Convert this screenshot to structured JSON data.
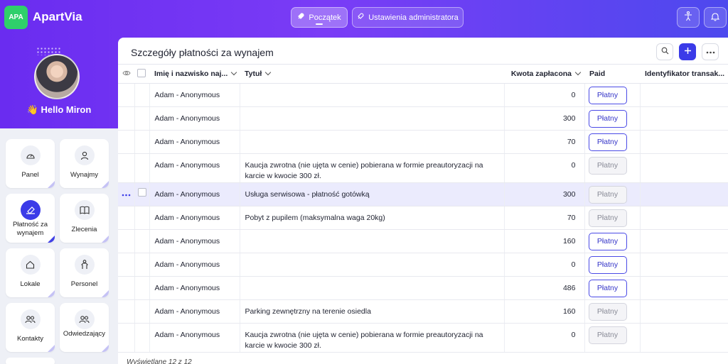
{
  "app": {
    "logo": "APA",
    "name": "ApartVia"
  },
  "nav": {
    "home": "Początek",
    "admin": "Ustawienia administratora"
  },
  "topbar_icons": [
    "accessibility-icon",
    "bell-icon"
  ],
  "profile": {
    "greeting": "👋 Hello Miron"
  },
  "sidebar": {
    "items": [
      {
        "label": "Panel",
        "icon": "dashboard-icon",
        "active": false
      },
      {
        "label": "Wynajmy",
        "icon": "user-icon",
        "active": false
      },
      {
        "label": "Płatność za wynajem",
        "icon": "payment-icon",
        "active": true
      },
      {
        "label": "Zlecenia",
        "icon": "book-icon",
        "active": false
      },
      {
        "label": "Lokale",
        "icon": "home-icon",
        "active": false
      },
      {
        "label": "Personel",
        "icon": "person-icon",
        "active": false
      },
      {
        "label": "Kontakty",
        "icon": "contacts-icon",
        "active": false
      },
      {
        "label": "Odwiedzający",
        "icon": "visitors-icon",
        "active": false
      }
    ]
  },
  "panel": {
    "title": "Szczegóły płatności za wynajem",
    "columns": {
      "name": "Imię i nazwisko naj...",
      "title": "Tytuł",
      "amount": "Kwota zapłacona",
      "paid": "Paid",
      "transaction": "Identyfikator transak..."
    },
    "rows": [
      {
        "name": "Adam - Anonymous",
        "title": "",
        "amount": "0",
        "paid": "Płatny",
        "paid_active": true
      },
      {
        "name": "Adam - Anonymous",
        "title": "",
        "amount": "300",
        "paid": "Płatny",
        "paid_active": true
      },
      {
        "name": "Adam - Anonymous",
        "title": "",
        "amount": "70",
        "paid": "Płatny",
        "paid_active": true
      },
      {
        "name": "Adam - Anonymous",
        "title": "Kaucja zwrotna (nie ujęta w cenie) pobierana w formie preautoryzacji na karcie w kwocie 300 zł.",
        "amount": "0",
        "paid": "Płatny",
        "paid_active": false
      },
      {
        "name": "Adam - Anonymous",
        "title": "Usługa serwisowa - płatność gotówką",
        "amount": "300",
        "paid": "Płatny",
        "paid_active": false
      },
      {
        "name": "Adam - Anonymous",
        "title": "Pobyt z pupilem (maksymalna waga 20kg)",
        "amount": "70",
        "paid": "Płatny",
        "paid_active": false
      },
      {
        "name": "Adam - Anonymous",
        "title": "",
        "amount": "160",
        "paid": "Płatny",
        "paid_active": true
      },
      {
        "name": "Adam - Anonymous",
        "title": "",
        "amount": "0",
        "paid": "Płatny",
        "paid_active": true
      },
      {
        "name": "Adam - Anonymous",
        "title": "",
        "amount": "486",
        "paid": "Płatny",
        "paid_active": true
      },
      {
        "name": "Adam - Anonymous",
        "title": "Parking zewnętrzny na terenie osiedla",
        "amount": "160",
        "paid": "Płatny",
        "paid_active": false
      },
      {
        "name": "Adam - Anonymous",
        "title": "Kaucja zwrotna (nie ujęta w cenie) pobierana w formie preautoryzacji na karcie w kwocie 300 zł.",
        "amount": "0",
        "paid": "Płatny",
        "paid_active": false
      }
    ],
    "footer": "Wyświetlane 12 z 12"
  },
  "colors": {
    "primary": "#3b3be8",
    "brand_green": "#2fcf6b",
    "header_gradient_start": "#6a2cf0",
    "header_gradient_end": "#4d49ee"
  }
}
